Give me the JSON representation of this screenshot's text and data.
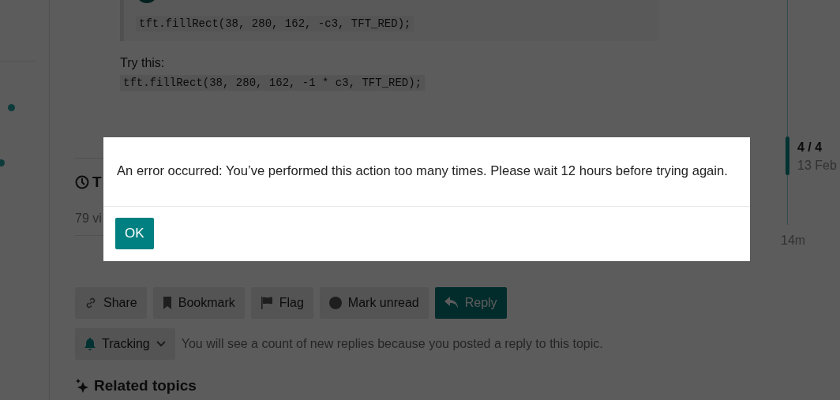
{
  "post": {
    "quote_code": "tft.fillRect(38, 280, 162, -c3, TFT_RED);",
    "text": "Try this:",
    "code": "tft.fillRect(38, 280, 162, -1 * c3, TFT_RED);"
  },
  "topic_footer": {
    "heading": "T",
    "views": "79 vi"
  },
  "timeline": {
    "position": "4 / 4",
    "date": "13 Feb",
    "end": "14m"
  },
  "footer_buttons": [
    {
      "label": "Share",
      "kind": "share"
    },
    {
      "label": "Bookmark",
      "kind": "bookmark"
    },
    {
      "label": "Flag",
      "kind": "flag"
    },
    {
      "label": "Mark unread",
      "kind": "unread"
    },
    {
      "label": "Reply",
      "kind": "reply"
    }
  ],
  "notifications": {
    "label": "Tracking",
    "reason": "You will see a count of new replies because you posted a reply to this topic."
  },
  "related": {
    "heading": "Related topics"
  },
  "modal": {
    "message": "An error occurred: You’ve performed this action too many times. Please wait 12 hours before trying again.",
    "button": "OK"
  }
}
